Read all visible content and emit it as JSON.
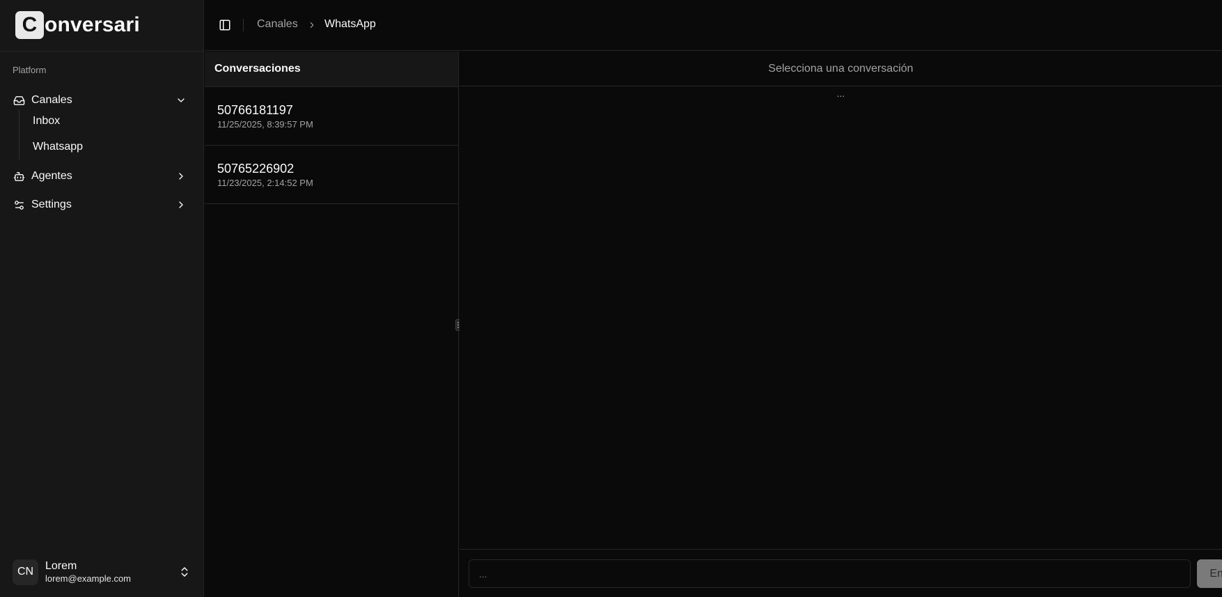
{
  "app": {
    "logo_letter": "C",
    "logo_text": "onversari"
  },
  "sidebar": {
    "group_label": "Platform",
    "items": [
      {
        "label": "Canales",
        "icon": "inbox-icon",
        "expanded": true,
        "children": [
          {
            "label": "Inbox"
          },
          {
            "label": "Whatsapp"
          }
        ]
      },
      {
        "label": "Agentes",
        "icon": "bot-icon",
        "expanded": false
      },
      {
        "label": "Settings",
        "icon": "sliders-icon",
        "expanded": false
      }
    ],
    "user": {
      "initials": "CN",
      "name": "Lorem",
      "email": "lorem@example.com"
    }
  },
  "breadcrumb": {
    "parent": "Canales",
    "current": "WhatsApp"
  },
  "conversations": {
    "title": "Conversaciones",
    "items": [
      {
        "phone": "50766181197",
        "date": "11/25/2025, 8:39:57 PM"
      },
      {
        "phone": "50765226902",
        "date": "11/23/2025, 2:14:52 PM"
      }
    ]
  },
  "chat": {
    "header": "Selecciona una conversación",
    "loading": "...",
    "input_placeholder": "...",
    "send_label": "Enviar"
  },
  "colors": {
    "background": "#0a0a0a",
    "sidebar": "#171717",
    "border": "#262626",
    "send_button": "#7a7a7a"
  }
}
